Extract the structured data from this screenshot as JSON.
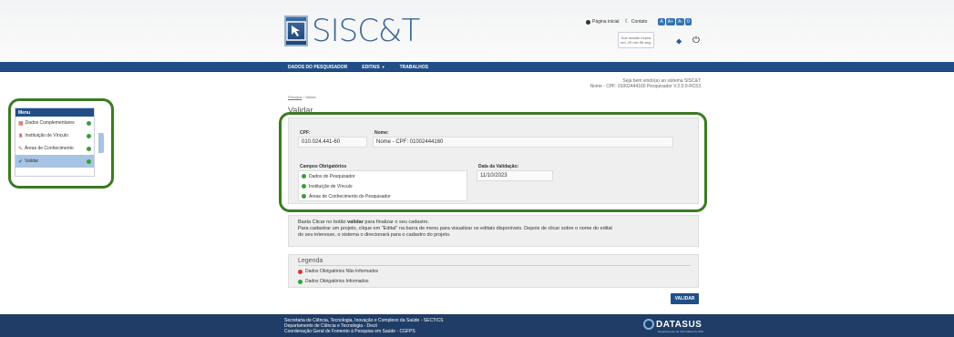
{
  "header": {
    "logo_text": "SISC&T",
    "links": {
      "home": "Página inicial",
      "contact": "Contato"
    },
    "font_buttons": [
      "A",
      "A+",
      "A-",
      "0"
    ],
    "session": [
      "Sua sessão expira",
      "em: 29 min 56 seg."
    ]
  },
  "nav": {
    "items": [
      {
        "label": "DADOS DO PESQUISADOR"
      },
      {
        "label": "EDITAIS"
      },
      {
        "label": "TRABALHOS"
      }
    ]
  },
  "welcome": {
    "line1": "Seja bem vindo(a) ao sistema SISC&T",
    "line2": "Nome - CPF: 01002444160 Pesquisador V.2.0.0-RC53"
  },
  "breadcrumb": {
    "home": "Principal",
    "sep": " / ",
    "current": "Validar"
  },
  "page_title": "Validar",
  "form": {
    "cpf_label": "CPF:",
    "cpf_value": "010.024.441-60",
    "nome_label": "Nome:",
    "nome_value": "Nome - CPF: 01002444160",
    "campos_label": "Campos Obrigatórios",
    "campos": [
      {
        "label": "Dados do Pesquisador",
        "status": "green"
      },
      {
        "label": "Instituição de Vínculo",
        "status": "green"
      },
      {
        "label": "Áreas de Conhecimento do Pesquisador",
        "status": "green"
      }
    ],
    "data_label": "Data da Validação:",
    "data_value": "11/10/2023"
  },
  "info": {
    "line1_pre": "Basta Clicar no botão ",
    "line1_bold": "validar",
    "line1_post": " para finalizar o seu cadastro.",
    "line2": "Para cadastrar um projeto, clique em \"Edital\" na barra de menu para visualizar os editais disponíveis. Depois de clicar sobre o nome do edital",
    "line3": "do seu interesse, o sistema o direcionará para o cadastro do projeto."
  },
  "legend": {
    "title": "Legenda",
    "items": [
      {
        "label": "Dados Obrigatórios Não Informados",
        "color": "#dd3333"
      },
      {
        "label": "Dados Obrigatórios Informados",
        "color": "#3b9d3b"
      }
    ]
  },
  "validate_button": "VALIDAR",
  "footer": {
    "line1": "Secretaria de Ciência, Tecnologia, Inovação e Complexo da Saúde - SECTICS",
    "line2": "Departamento de Ciência e Tecnologia - Decit",
    "line3": "Coordenação Geral de Fomento à Pesquisa em Saúde - CGFPS",
    "brand": "DATASUS",
    "brand_sub": "Departamento de Informática do SUS"
  },
  "menu": {
    "title": "Menu",
    "items": [
      {
        "label": "Dados Complementares",
        "status": "green"
      },
      {
        "label": "Instituição de Vínculo",
        "status": "green"
      },
      {
        "label": "Áreas de Conhecimento",
        "status": "green"
      },
      {
        "label": "Validar",
        "status": "green"
      }
    ]
  }
}
